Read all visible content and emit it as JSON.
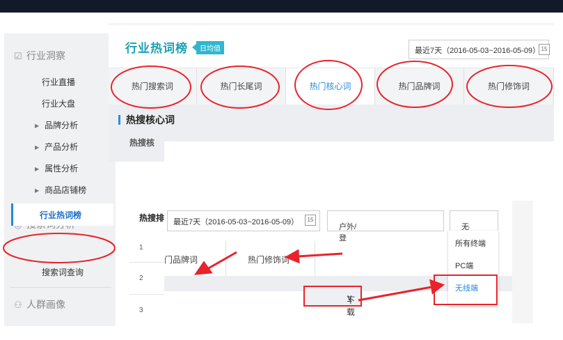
{
  "sidebar": {
    "section1": "行业洞察",
    "item_live": "行业直播",
    "item_market": "行业大盘",
    "sub_brand": "品牌分析",
    "sub_product": "产品分析",
    "sub_attr": "属性分析",
    "sub_shop": "商品店铺榜",
    "section2": "搜索词分析",
    "active_item": "行业热词榜",
    "item_query": "搜索词查询",
    "section3": "人群画像"
  },
  "top": {
    "title": "行业热词榜",
    "badge": "日均值",
    "date_range": "最近7天（2016-05-03~2016-05-09）",
    "calendar": "15",
    "tabs": [
      "热门搜索词",
      "热门长尾词",
      "热门核心词",
      "热门品牌词",
      "热门修饰词"
    ],
    "section_title": "热搜核心词",
    "section_title_partial": "热搜核"
  },
  "lower": {
    "rank_label": "热搜排名",
    "date_range": "最近7天（2016-05-03~2016-05-09）",
    "calendar": "15",
    "category": "户外/登山/…营/旅行用品",
    "terminal": "无线端",
    "rows": [
      "1",
      "2",
      "3"
    ],
    "col_brand": "门品牌词",
    "col_modifier": "热门修饰词",
    "dropdown": [
      "所有终端",
      "PC端",
      "无线端"
    ],
    "download": "下载"
  },
  "colors": {
    "accent": "#2a8fd8",
    "title": "#1aa0b5",
    "annotation": "#e8232b"
  }
}
